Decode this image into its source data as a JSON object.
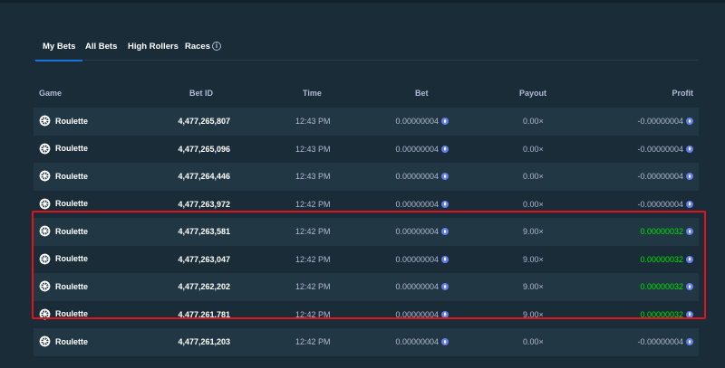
{
  "tabs": [
    {
      "label": "My Bets",
      "active": true
    },
    {
      "label": "All Bets",
      "active": false
    },
    {
      "label": "High Rollers",
      "active": false
    },
    {
      "label": "Races",
      "active": false
    }
  ],
  "tabs_info_icon": "info-icon",
  "columns": [
    "Game",
    "Bet ID",
    "Time",
    "Bet",
    "Payout",
    "Profit"
  ],
  "rows": [
    {
      "game": "Roulette",
      "bet_id": "4,477,265,807",
      "time": "12:43 PM",
      "bet": "0.00000004",
      "payout": "0.00×",
      "profit": "-0.00000004",
      "win": false
    },
    {
      "game": "Roulette",
      "bet_id": "4,477,265,096",
      "time": "12:43 PM",
      "bet": "0.00000004",
      "payout": "0.00×",
      "profit": "-0.00000004",
      "win": false
    },
    {
      "game": "Roulette",
      "bet_id": "4,477,264,446",
      "time": "12:43 PM",
      "bet": "0.00000004",
      "payout": "0.00×",
      "profit": "-0.00000004",
      "win": false
    },
    {
      "game": "Roulette",
      "bet_id": "4,477,263,972",
      "time": "12:42 PM",
      "bet": "0.00000004",
      "payout": "0.00×",
      "profit": "-0.00000004",
      "win": false
    },
    {
      "game": "Roulette",
      "bet_id": "4,477,263,581",
      "time": "12:42 PM",
      "bet": "0.00000004",
      "payout": "9.00×",
      "profit": "0.00000032",
      "win": true
    },
    {
      "game": "Roulette",
      "bet_id": "4,477,263,047",
      "time": "12:42 PM",
      "bet": "0.00000004",
      "payout": "9.00×",
      "profit": "0.00000032",
      "win": true
    },
    {
      "game": "Roulette",
      "bet_id": "4,477,262,202",
      "time": "12:42 PM",
      "bet": "0.00000004",
      "payout": "9.00×",
      "profit": "0.00000032",
      "win": true
    },
    {
      "game": "Roulette",
      "bet_id": "4,477,261,781",
      "time": "12:42 PM",
      "bet": "0.00000004",
      "payout": "9.00×",
      "profit": "0.00000032",
      "win": true
    },
    {
      "game": "Roulette",
      "bet_id": "4,477,261,203",
      "time": "12:42 PM",
      "bet": "0.00000004",
      "payout": "0.00×",
      "profit": "-0.00000004",
      "win": false
    }
  ],
  "icons": {
    "game": "roulette-wheel-icon",
    "currency": "ethereum-coin-icon"
  },
  "colors": {
    "background": "#1a2c38",
    "row_alt": "#213743",
    "win": "#00e701",
    "tab_underline": "#1475e1",
    "highlight_box": "#e4121a"
  }
}
